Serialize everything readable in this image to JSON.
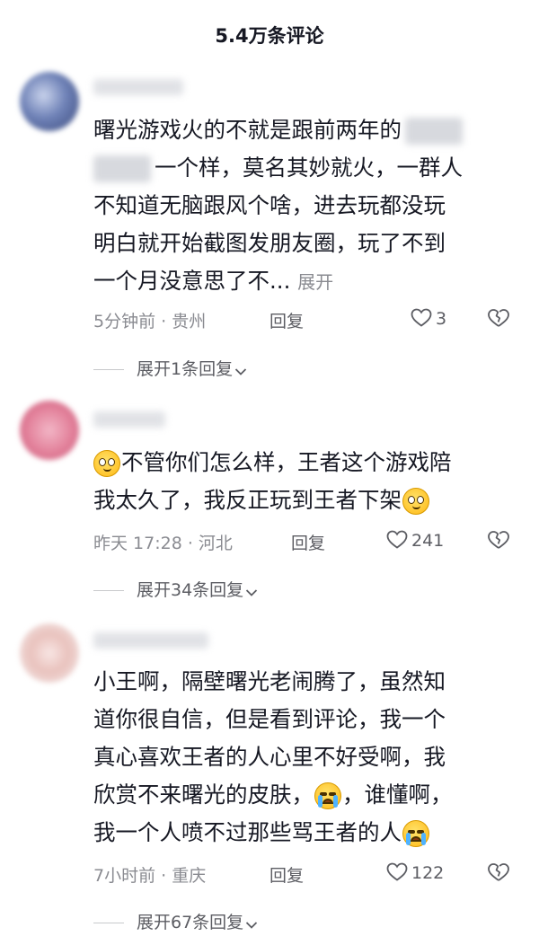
{
  "header": {
    "title": "5.4万条评论"
  },
  "comments": [
    {
      "text_a": "曙光游戏火的不就是跟前两年的",
      "text_b": "一个样，莫名其妙就火，一群人",
      "text_c": "不知道无脑跟风个啥，进去玩都没玩",
      "text_d": "明白就开始截图发朋友圈，玩了不到",
      "text_e": "一个月没意思了不...",
      "expand_label": "展开",
      "time_location": "5分钟前 · 贵州",
      "reply_label": "回复",
      "likes": "3",
      "more_replies": "展开1条回复"
    },
    {
      "text_a": "不管你们怎么样，王者这个游戏陪",
      "text_b": "我太久了，我反正玩到王者下架",
      "time_location": "昨天 17:28 · 河北",
      "reply_label": "回复",
      "likes": "241",
      "more_replies": "展开34条回复"
    },
    {
      "text_a": "小王啊，隔壁曙光老闹腾了，虽然知",
      "text_b": "道你很自信，但是看到评论，我一个",
      "text_c": "真心喜欢王者的人心里不好受啊，我",
      "text_d": "欣赏不来曙光的皮肤，",
      "text_d2": "，谁懂啊，",
      "text_e": "我一个人喷不过那些骂王者的人",
      "time_location": "7小时前 · 重庆",
      "reply_label": "回复",
      "likes": "122",
      "more_replies": "展开67条回复"
    }
  ],
  "icons": {
    "like": "heart-outline-icon",
    "dislike": "broken-heart-icon",
    "chevron": "chevron-down-icon",
    "emoji_smile": "blushing-smile-emoji",
    "emoji_cry": "crying-face-emoji"
  }
}
